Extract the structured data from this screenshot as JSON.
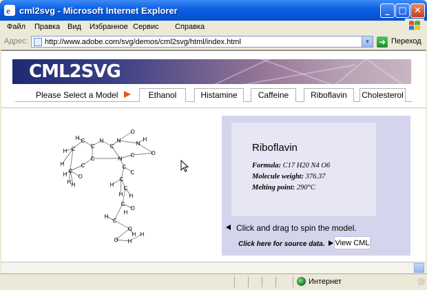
{
  "window": {
    "title": "cml2svg - Microsoft Internet Explorer",
    "minimize": "_",
    "maximize": "□",
    "close": "✕"
  },
  "menu": [
    "Файл",
    "Правка",
    "Вид",
    "Избранное",
    "Сервис",
    "Справка"
  ],
  "address": {
    "label": "Адрес:",
    "url": "http://www.adobe.com/svg/demos/cml2svg/html/index.html",
    "go_label": "Переход",
    "go_icon": "go-arrow-icon"
  },
  "banner": {
    "logo": "CML2SVG"
  },
  "model_selector": {
    "label": "Please Select a Model",
    "tabs": [
      "Ethanol",
      "Histamine",
      "Caffeine",
      "Riboflavin",
      "Cholesterol"
    ]
  },
  "molecule": {
    "atoms": [
      {
        "s": "H"
      },
      {
        "s": "C"
      },
      {
        "s": "C"
      },
      {
        "s": "C"
      },
      {
        "s": "H"
      },
      {
        "s": "C"
      },
      {
        "s": "C"
      },
      {
        "s": "N"
      },
      {
        "s": "C"
      },
      {
        "s": "N"
      },
      {
        "s": "O"
      },
      {
        "s": "N"
      },
      {
        "s": "H"
      },
      {
        "s": "O"
      },
      {
        "s": "C"
      },
      {
        "s": "N"
      },
      {
        "s": "C"
      },
      {
        "s": "C"
      },
      {
        "s": "C"
      },
      {
        "s": "H"
      },
      {
        "s": "H"
      },
      {
        "s": "C"
      },
      {
        "s": "H"
      },
      {
        "s": "C"
      },
      {
        "s": "O"
      },
      {
        "s": "H"
      },
      {
        "s": "C"
      },
      {
        "s": "H"
      },
      {
        "s": "O"
      },
      {
        "s": "H"
      },
      {
        "s": "O"
      },
      {
        "s": "H"
      },
      {
        "s": "H"
      },
      {
        "s": "C"
      },
      {
        "s": "O"
      },
      {
        "s": "H"
      },
      {
        "s": "H"
      },
      {
        "s": "H"
      },
      {
        "s": "H"
      }
    ]
  },
  "info": {
    "name": "Riboflavin",
    "formula_label": "Formula:",
    "formula": "C17 H20 N4 O6",
    "weight_label": "Molecule weight:",
    "weight": "376.37",
    "melting_label": "Melting point:",
    "melting": "290°C",
    "spin_text": "Click and drag to spin the model.",
    "source_text": "Click here for source data.",
    "view_cml": "View CML"
  },
  "status": {
    "zone": "Интернет"
  }
}
